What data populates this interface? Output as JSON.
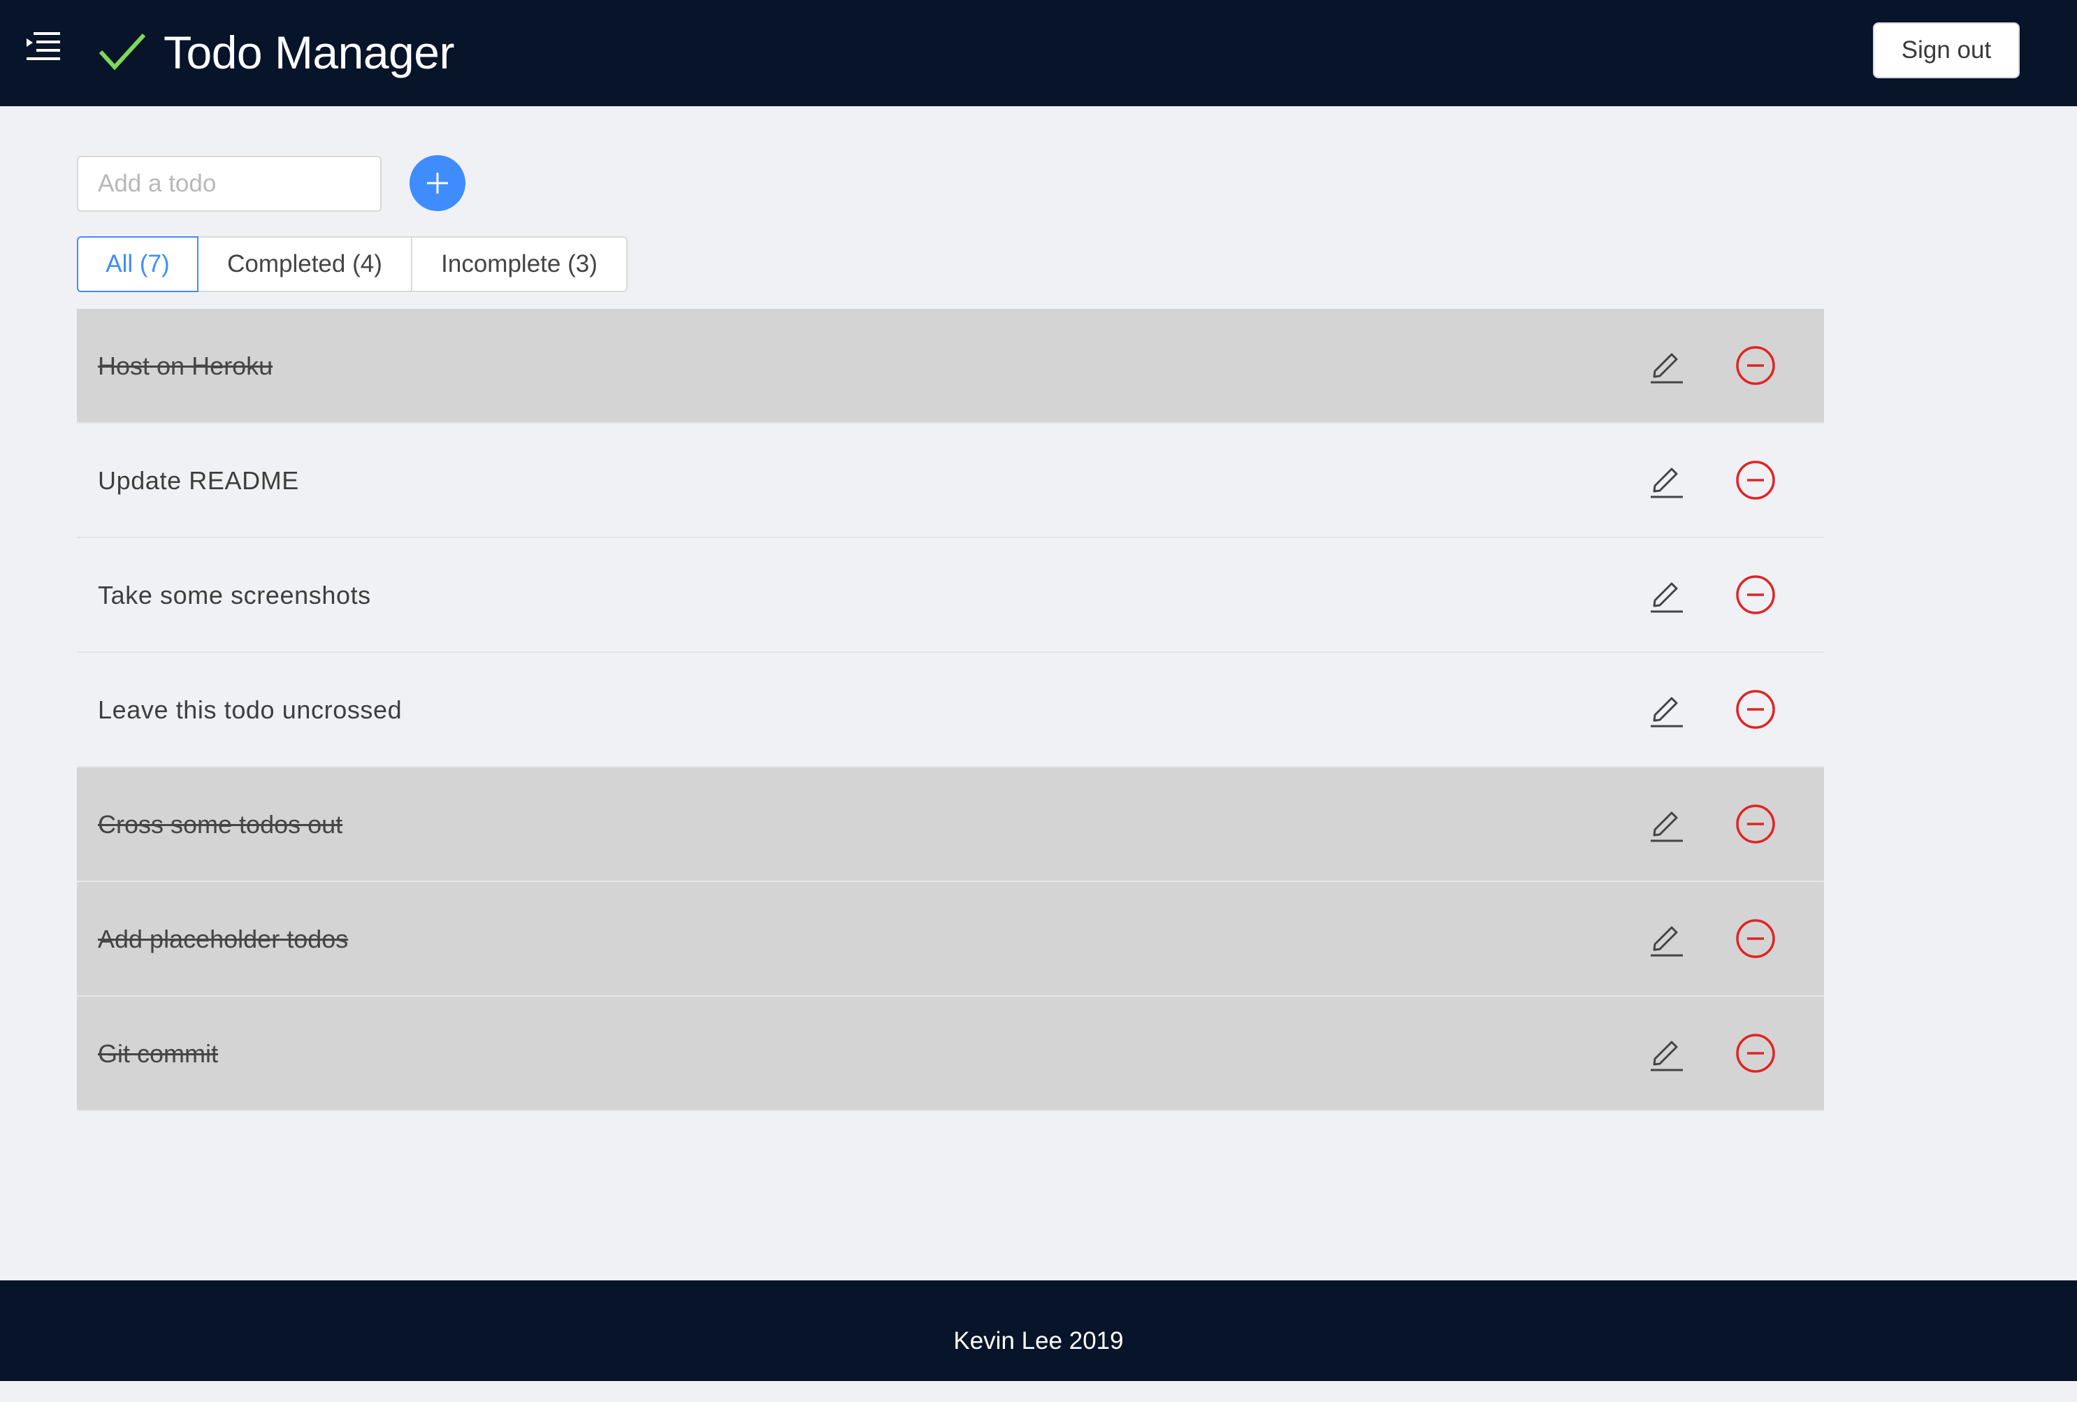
{
  "header": {
    "title": "Todo Manager",
    "menu_icon": "menu-indent-icon",
    "brand_icon": "checkmark-icon",
    "signout_label": "Sign out"
  },
  "add_todo": {
    "placeholder": "Add a todo",
    "value": "",
    "add_icon": "plus-icon"
  },
  "tabs": [
    {
      "label": "All (7)",
      "active": true
    },
    {
      "label": "Completed (4)",
      "active": false
    },
    {
      "label": "Incomplete (3)",
      "active": false
    }
  ],
  "todos": [
    {
      "text": "Host on Heroku",
      "completed": true
    },
    {
      "text": "Update README",
      "completed": false
    },
    {
      "text": "Take some screenshots",
      "completed": false
    },
    {
      "text": "Leave this todo uncrossed",
      "completed": false
    },
    {
      "text": "Cross some todos out",
      "completed": true
    },
    {
      "text": "Add placeholder todos",
      "completed": true
    },
    {
      "text": "Git commit",
      "completed": true
    }
  ],
  "row_icons": {
    "edit": "pencil-edit-icon",
    "delete": "minus-circle-icon"
  },
  "footer": {
    "text": "Kevin Lee 2019"
  },
  "colors": {
    "header_bg": "#07142a",
    "page_bg": "#f0f1f5",
    "accent_blue": "#3f8cff",
    "brand_green": "#7ed957",
    "delete_red": "#e02424",
    "completed_row_bg": "#d4d4d4"
  }
}
